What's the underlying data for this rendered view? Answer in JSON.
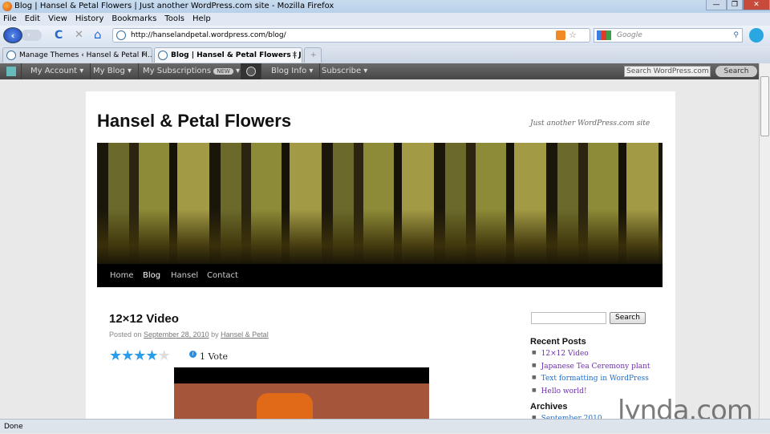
{
  "window": {
    "title": "Blog | Hansel & Petal Flowers | Just another WordPress.com site - Mozilla Firefox",
    "minimize": "—",
    "restore": "❐",
    "close": "✕"
  },
  "menu": [
    "File",
    "Edit",
    "View",
    "History",
    "Bookmarks",
    "Tools",
    "Help"
  ],
  "nav": {
    "url": "http://hanselandpetal.wordpress.com/blog/",
    "search_placeholder": "Google",
    "back": "‹",
    "forward": "›",
    "reload": "C",
    "stop": "✕",
    "home": "⌂"
  },
  "tabs": [
    {
      "label": "Manage Themes ‹ Hansel & Petal Fl...",
      "close": "✕"
    },
    {
      "label": "Blog | Hansel & Petal Flowers | Ju...",
      "close": "✕"
    }
  ],
  "new_tab": "+",
  "adminbar": {
    "items": [
      "My Account ▾",
      "My Blog ▾",
      "My Subscriptions",
      "Blog Info ▾",
      "Subscribe ▾"
    ],
    "new_badge": "NEW",
    "arrow": "▾",
    "search_placeholder": "Search WordPress.com",
    "search_button": "Search"
  },
  "site": {
    "title": "Hansel & Petal Flowers",
    "tagline": "Just another WordPress.com site",
    "nav": [
      "Home",
      "Blog",
      "Hansel",
      "Contact"
    ]
  },
  "post": {
    "title": "12×12 Video",
    "posted_on": "Posted on",
    "date": "September 28, 2010",
    "by": "by",
    "author": "Hansel & Petal",
    "rating": 4,
    "rating_max": 5,
    "votes": "1 Vote",
    "info": "i"
  },
  "sidebar": {
    "search_button": "Search",
    "recent_title": "Recent Posts",
    "recent": [
      "12×12 Video",
      "Japanese Tea Ceremony plant",
      "Text formatting in WordPress",
      "Hello world!"
    ],
    "archives_title": "Archives",
    "archives": [
      "September 2010"
    ]
  },
  "watermark": "lynda.com",
  "status": "Done"
}
